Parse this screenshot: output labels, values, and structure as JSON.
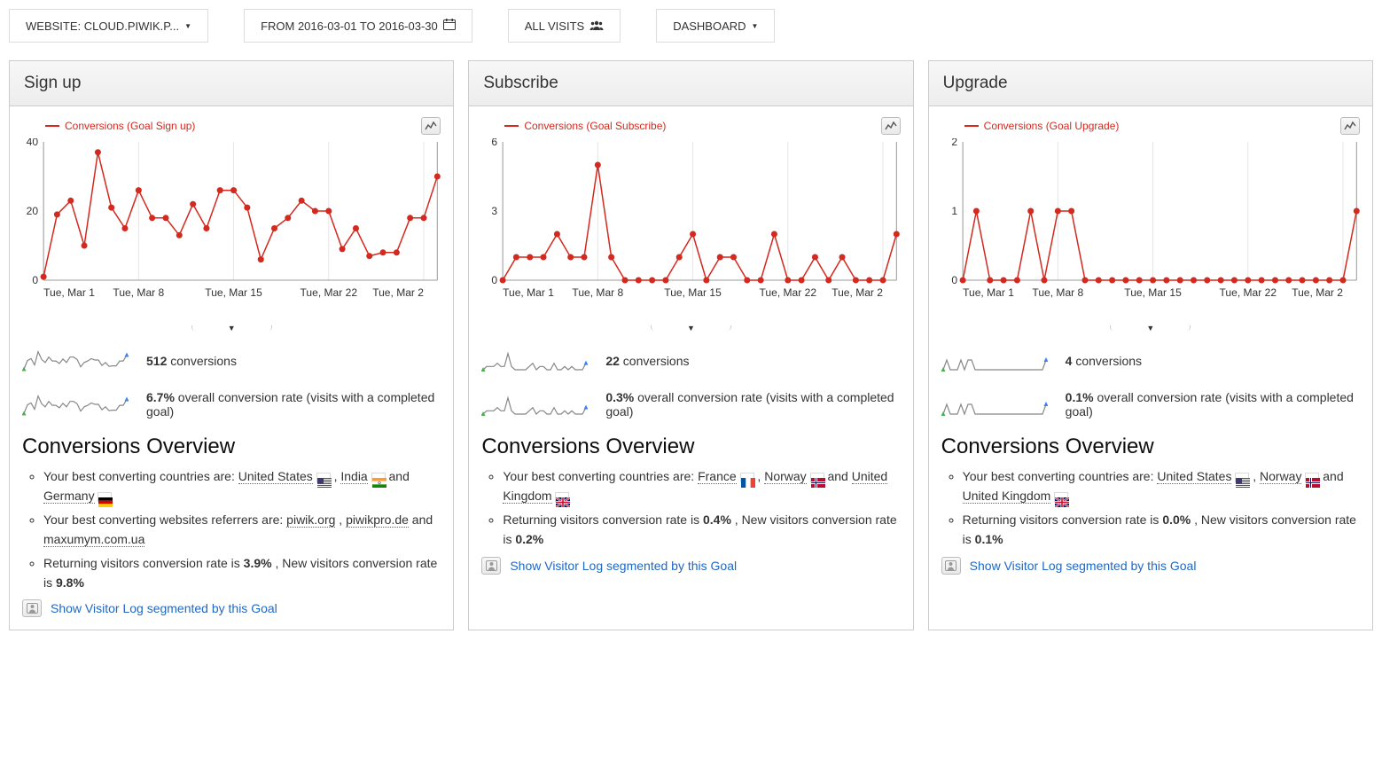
{
  "header": {
    "website": "WEBSITE: CLOUD.PIWIK.P...",
    "date_range": "FROM 2016-03-01 TO 2016-03-30",
    "visits": "ALL VISITS",
    "dashboard": "DASHBOARD"
  },
  "chart_data": [
    {
      "type": "line",
      "title": "Sign up",
      "legend": "Conversions (Goal Sign up)",
      "x_ticks": [
        "Tue, Mar 1",
        "Tue, Mar 8",
        "Tue, Mar 15",
        "Tue, Mar 22",
        "Tue, Mar 2"
      ],
      "y_ticks": [
        0,
        20,
        40
      ],
      "ylim": [
        0,
        40
      ],
      "x_days": [
        1,
        2,
        3,
        4,
        5,
        6,
        7,
        8,
        9,
        10,
        11,
        12,
        13,
        14,
        15,
        16,
        17,
        18,
        19,
        20,
        21,
        22,
        23,
        24,
        25,
        26,
        27,
        28,
        29,
        30
      ],
      "values": [
        1,
        19,
        23,
        10,
        37,
        21,
        15,
        26,
        18,
        18,
        13,
        22,
        15,
        26,
        26,
        21,
        6,
        15,
        18,
        23,
        20,
        20,
        9,
        15,
        7,
        8,
        8,
        18,
        18,
        30
      ]
    },
    {
      "type": "line",
      "title": "Subscribe",
      "legend": "Conversions (Goal Subscribe)",
      "x_ticks": [
        "Tue, Mar 1",
        "Tue, Mar 8",
        "Tue, Mar 15",
        "Tue, Mar 22",
        "Tue, Mar 2"
      ],
      "y_ticks": [
        0,
        3,
        6
      ],
      "ylim": [
        0,
        6
      ],
      "x_days": [
        1,
        2,
        3,
        4,
        5,
        6,
        7,
        8,
        9,
        10,
        11,
        12,
        13,
        14,
        15,
        16,
        17,
        18,
        19,
        20,
        21,
        22,
        23,
        24,
        25,
        26,
        27,
        28,
        29,
        30
      ],
      "values": [
        0,
        1,
        1,
        1,
        2,
        1,
        1,
        5,
        1,
        0,
        0,
        0,
        0,
        1,
        2,
        0,
        1,
        1,
        0,
        0,
        2,
        0,
        0,
        1,
        0,
        1,
        0,
        0,
        0,
        2
      ]
    },
    {
      "type": "line",
      "title": "Upgrade",
      "legend": "Conversions (Goal Upgrade)",
      "x_ticks": [
        "Tue, Mar 1",
        "Tue, Mar 8",
        "Tue, Mar 15",
        "Tue, Mar 22",
        "Tue, Mar 2"
      ],
      "y_ticks": [
        0,
        1,
        2
      ],
      "ylim": [
        0,
        2
      ],
      "x_days": [
        1,
        2,
        3,
        4,
        5,
        6,
        7,
        8,
        9,
        10,
        11,
        12,
        13,
        14,
        15,
        16,
        17,
        18,
        19,
        20,
        21,
        22,
        23,
        24,
        25,
        26,
        27,
        28,
        29,
        30
      ],
      "values": [
        0,
        1,
        0,
        0,
        0,
        1,
        0,
        1,
        1,
        0,
        0,
        0,
        0,
        0,
        0,
        0,
        0,
        0,
        0,
        0,
        0,
        0,
        0,
        0,
        0,
        0,
        0,
        0,
        0,
        1
      ]
    }
  ],
  "widgets": [
    {
      "title": "Sign up",
      "conversions_value": "512",
      "conversions_label": " conversions",
      "rate_value": "6.7%",
      "rate_label": " overall conversion rate (visits with a completed goal)",
      "overview_title": "Conversions Overview",
      "countries_prefix": "Your best converting countries are: ",
      "countries": [
        {
          "name": "United States",
          "flag": "us"
        },
        {
          "name": "India",
          "flag": "in"
        },
        {
          "name": "Germany",
          "flag": "de"
        }
      ],
      "referrers_prefix": "Your best converting websites referrers are: ",
      "referrers": [
        "piwik.org",
        "piwikpro.de",
        "maxumym.com.ua"
      ],
      "rv_text_a": "Returning visitors conversion rate is ",
      "rv_val_a": "3.9%",
      "rv_text_b": " , New visitors conversion rate is ",
      "rv_val_b": "9.8%",
      "vlog": "Show Visitor Log segmented by this Goal"
    },
    {
      "title": "Subscribe",
      "conversions_value": "22",
      "conversions_label": " conversions",
      "rate_value": "0.3%",
      "rate_label": " overall conversion rate (visits with a completed goal)",
      "overview_title": "Conversions Overview",
      "countries_prefix": "Your best converting countries are: ",
      "countries": [
        {
          "name": "France",
          "flag": "fr"
        },
        {
          "name": "Norway",
          "flag": "no"
        },
        {
          "name": "United Kingdom",
          "flag": "uk"
        }
      ],
      "rv_text_a": "Returning visitors conversion rate is ",
      "rv_val_a": "0.4%",
      "rv_text_b": " , New visitors conversion rate is ",
      "rv_val_b": "0.2%",
      "vlog": "Show Visitor Log segmented by this Goal"
    },
    {
      "title": "Upgrade",
      "conversions_value": "4",
      "conversions_label": " conversions",
      "rate_value": "0.1%",
      "rate_label": " overall conversion rate (visits with a completed goal)",
      "overview_title": "Conversions Overview",
      "countries_prefix": "Your best converting countries are: ",
      "countries": [
        {
          "name": "United States",
          "flag": "us"
        },
        {
          "name": "Norway",
          "flag": "no"
        },
        {
          "name": "United Kingdom",
          "flag": "uk"
        }
      ],
      "rv_text_a": "Returning visitors conversion rate is ",
      "rv_val_a": "0.0%",
      "rv_text_b": " , New visitors conversion rate is ",
      "rv_val_b": "0.1%",
      "vlog": "Show Visitor Log segmented by this Goal"
    }
  ],
  "joiners": {
    "and": "and",
    "comma": " , "
  }
}
